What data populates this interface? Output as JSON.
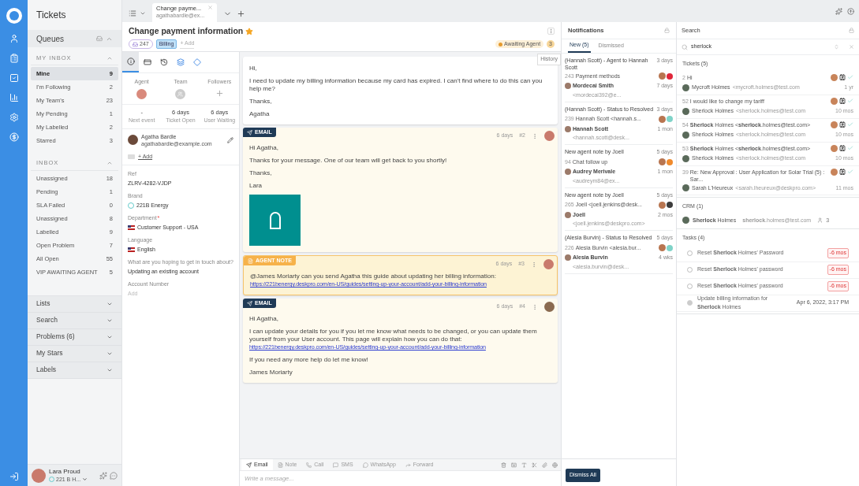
{
  "sidebar": {
    "title": "Tickets",
    "queues_label": "Queues",
    "sections": [
      {
        "title": "MY INBOX",
        "expanded": true,
        "items": [
          {
            "label": "Mine",
            "count": "9",
            "selected": true
          },
          {
            "label": "I'm Following",
            "count": "2",
            "selected": false
          },
          {
            "label": "My Team's",
            "count": "23",
            "selected": false
          },
          {
            "label": "My Pending",
            "count": "1",
            "selected": false
          },
          {
            "label": "My Labelled",
            "count": "2",
            "selected": false
          },
          {
            "label": "Starred",
            "count": "3",
            "selected": false
          }
        ]
      },
      {
        "title": "INBOX",
        "expanded": true,
        "items": [
          {
            "label": "Unassigned",
            "count": "18",
            "selected": false
          },
          {
            "label": "Pending",
            "count": "1",
            "selected": false
          },
          {
            "label": "SLA Failed",
            "count": "0",
            "selected": false
          },
          {
            "label": "Unassigned",
            "count": "8",
            "selected": false
          },
          {
            "label": "Labelled",
            "count": "9",
            "selected": false
          },
          {
            "label": "Open Problem",
            "count": "7",
            "selected": false
          },
          {
            "label": "All Open",
            "count": "55",
            "selected": false
          },
          {
            "label": "VIP AWAITING AGENT",
            "count": "5",
            "selected": false
          }
        ]
      }
    ],
    "groups": [
      {
        "label": "Lists",
        "expanded": false
      },
      {
        "label": "Search",
        "expanded": false
      },
      {
        "label": "Problems (6)",
        "expanded": false
      },
      {
        "label": "My Stars",
        "expanded": false
      },
      {
        "label": "Labels",
        "expanded": false
      }
    ],
    "user": {
      "name": "Lara Proud",
      "team": "221 B H..."
    }
  },
  "tab": {
    "title": "Change payme...",
    "subtitle": "agathabardle@ex..."
  },
  "ticket": {
    "title": "Change payment information",
    "starred": true,
    "id": "247",
    "labels": [
      "Billing"
    ],
    "add_label": "+ Add",
    "status": "Awaiting Agent",
    "status_count": "3",
    "tooltip": "History"
  },
  "info_tabs": [
    {
      "kind": "info",
      "selected": true
    },
    {
      "kind": "card",
      "selected": false
    },
    {
      "kind": "history",
      "selected": false
    },
    {
      "kind": "app",
      "selected": false
    },
    {
      "kind": "diamond",
      "selected": false
    }
  ],
  "assignees": [
    {
      "label": "Agent",
      "kind": "avatar"
    },
    {
      "label": "Team",
      "kind": "team"
    },
    {
      "label": "Followers",
      "kind": "add"
    }
  ],
  "stats": [
    {
      "value": "-",
      "label": "Next event"
    },
    {
      "value": "6 days",
      "label": "Ticket Open"
    },
    {
      "value": "6 days",
      "label": "User Waiting"
    }
  ],
  "requester": {
    "name": "Agatha Bardle",
    "email": "agathabardle@example.com",
    "cc_add": "+ Add"
  },
  "fields": [
    {
      "label": "Ref",
      "value": "ZLRV-4282-VJDP",
      "kind": "text"
    },
    {
      "label": "Brand",
      "value": "221B Energy",
      "kind": "brand"
    },
    {
      "label": "Department",
      "required_mark": "*",
      "value": "Customer Support - USA",
      "kind": "flag"
    },
    {
      "label": "Language",
      "value": "English",
      "kind": "flag"
    },
    {
      "label": "What are you hoping to get in touch about?",
      "value": "Updating an existing account",
      "kind": "text"
    },
    {
      "label": "Account Number",
      "placeholder": "Add",
      "kind": "empty"
    }
  ],
  "messages": [
    {
      "kind": "customer",
      "paragraphs": [
        {
          "text": "Hi,"
        },
        {
          "text": "I need to update my billing information because my card has expired. I can't find where to do this can you help me?"
        },
        {
          "text": "Thanks,"
        },
        {
          "text": "Agatha"
        }
      ]
    },
    {
      "kind": "email",
      "badge": "EMAIL",
      "time": "6 days",
      "number": "#2",
      "logo": true,
      "paragraphs": [
        {
          "text": "Hi Agatha,"
        },
        {
          "text": "Thanks for your message. One of our team will get back to you shortly!"
        },
        {
          "text": "Thanks,"
        },
        {
          "text": "Lara"
        }
      ]
    },
    {
      "kind": "note",
      "badge": "AGENT NOTE",
      "time": "6 days",
      "number": "#3",
      "logo": false,
      "paragraphs": [
        {
          "text": "@James Moriarty can you send Agatha this guide about updating her billing information:",
          "link": "https://221benergy.deskpro.com/en-US/guides/setting-up-your-account/add-your-billing-information"
        }
      ]
    },
    {
      "kind": "email",
      "badge": "EMAIL",
      "time": "6 days",
      "number": "#4",
      "logo": false,
      "paragraphs": [
        {
          "text": "Hi Agatha,"
        },
        {
          "text": "I can update your details for you if you let me know what needs to be changed, or you can update them yourself from your User account. This page will explain how you can do that:",
          "link": "https://221benergy.deskpro.com/en-US/guides/setting-up-your-account/add-your-billing-information"
        },
        {
          "text": "If you need any more help do let me know!"
        },
        {
          "text": "James Moriarty"
        }
      ]
    }
  ],
  "composer": {
    "tabs": [
      {
        "label": "Email",
        "kind": "email",
        "selected": true
      },
      {
        "label": "Note",
        "kind": "note",
        "selected": false
      },
      {
        "label": "Call",
        "kind": "call",
        "selected": false
      },
      {
        "label": "SMS",
        "kind": "sms",
        "selected": false
      },
      {
        "label": "WhatsApp",
        "kind": "whatsapp",
        "selected": false
      },
      {
        "label": "Forward",
        "kind": "forward",
        "selected": false
      }
    ],
    "placeholder": "Write a message..."
  },
  "notifications": {
    "title": "Notifications",
    "tabs": [
      {
        "label": "New (5)",
        "selected": true
      },
      {
        "label": "Dismissed",
        "selected": false
      }
    ],
    "items": [
      {
        "title": "(Hannah Scott) - Agent to Hannah Scott",
        "time": "3 days",
        "ticket_id": "243",
        "subject": "Payment methods",
        "person": "Mordecai Smith",
        "email": "<mordecai392@e...",
        "age": "7 days",
        "color": "#e0263a"
      },
      {
        "title": "(Hannah Scott) - Status to Resolved",
        "time": "3 days",
        "ticket_id": "239",
        "subject": "Hannah Scott <hannah.s...",
        "person": "Hannah Scott",
        "email": "<hannah.scott@desk...",
        "age": "1 mon",
        "color": "#7fd3c8"
      },
      {
        "title": "New agent note by Joell",
        "time": "5 days",
        "ticket_id": "94",
        "subject": "Chat follow up",
        "person": "Audrey Merivale",
        "email": "<audreym84@ex...",
        "age": "1 mon",
        "color": "#f08a2c"
      },
      {
        "title": "New agent note by Joell",
        "time": "5 days",
        "ticket_id": "265",
        "subject": "Joell <joell.jenkins@desk...",
        "person": "Joell",
        "email": "<joell.jenkins@deskpro.com>",
        "age": "2 mos",
        "color": "#3c3c3c"
      },
      {
        "title": "(Alesia Burvin) - Status to Resolved",
        "time": "5 days",
        "ticket_id": "226",
        "subject": "Alesia Burvin <alesia.bur...",
        "person": "Alesia Burvin",
        "email": "<alesia.burvin@desk...",
        "age": "4 wks",
        "color": "#7fd3c8"
      }
    ],
    "dismiss": "Dismiss All"
  },
  "search": {
    "title": "Search",
    "query": "sherlock",
    "sections": [
      {
        "kind": "tickets",
        "title": "Tickets (5)",
        "items": [
          {
            "id": "2",
            "subject": "Hi",
            "person": "Mycroft Holmes",
            "email": "<mycroft.holmes@test.com",
            "age": "1 yr"
          },
          {
            "id": "52",
            "subject": "I would like to change my tariff",
            "person": "Sherlock Holmes",
            "email": "<sherlock.holmes@test.com",
            "age": "10 mos"
          },
          {
            "id": "54",
            "subject": "**Sherlock** Holmes <**sherlock**.holmes@test.com>",
            "person": "Sherlock Holmes",
            "email": "<sherlock.holmes@test.com",
            "age": "10 mos"
          },
          {
            "id": "53",
            "subject": "**Sherlock** Holmes <**sherlock**.holmes@test.com>",
            "person": "Sherlock Holmes",
            "email": "<sherlock.holmes@test.com",
            "age": "10 mos"
          },
          {
            "id": "39",
            "subject": "Re: New Approval : User Application for Solar Trial (5) : Sar...",
            "person": "Sarah L'Heureux",
            "email": "<sarah.lheureux@deskpro.com>",
            "age": "11 mos"
          }
        ]
      },
      {
        "kind": "crm",
        "title": "CRM (1)",
        "items": [
          {
            "name": "**Sherlock** Holmes",
            "email": "**sherlock**.holmes@test.com",
            "count": "3"
          }
        ]
      },
      {
        "kind": "tasks",
        "title": "Tasks (4)",
        "items": [
          {
            "title": "Reset **Sherlock** Holmes' Password",
            "due": "-6 mos",
            "done": false,
            "overdue": true
          },
          {
            "title": "Reset **Sherlock** Holmes' password",
            "due": "-6 mos",
            "done": false,
            "overdue": true
          },
          {
            "title": "Reset **Sherlock** Holmes' password",
            "due": "-6 mos",
            "done": false,
            "overdue": true
          },
          {
            "title": "Update billing information for **Sherlock** Holmes",
            "due": "Apr 6, 2022, 3:17 PM",
            "done": true,
            "overdue": false
          }
        ]
      }
    ]
  }
}
